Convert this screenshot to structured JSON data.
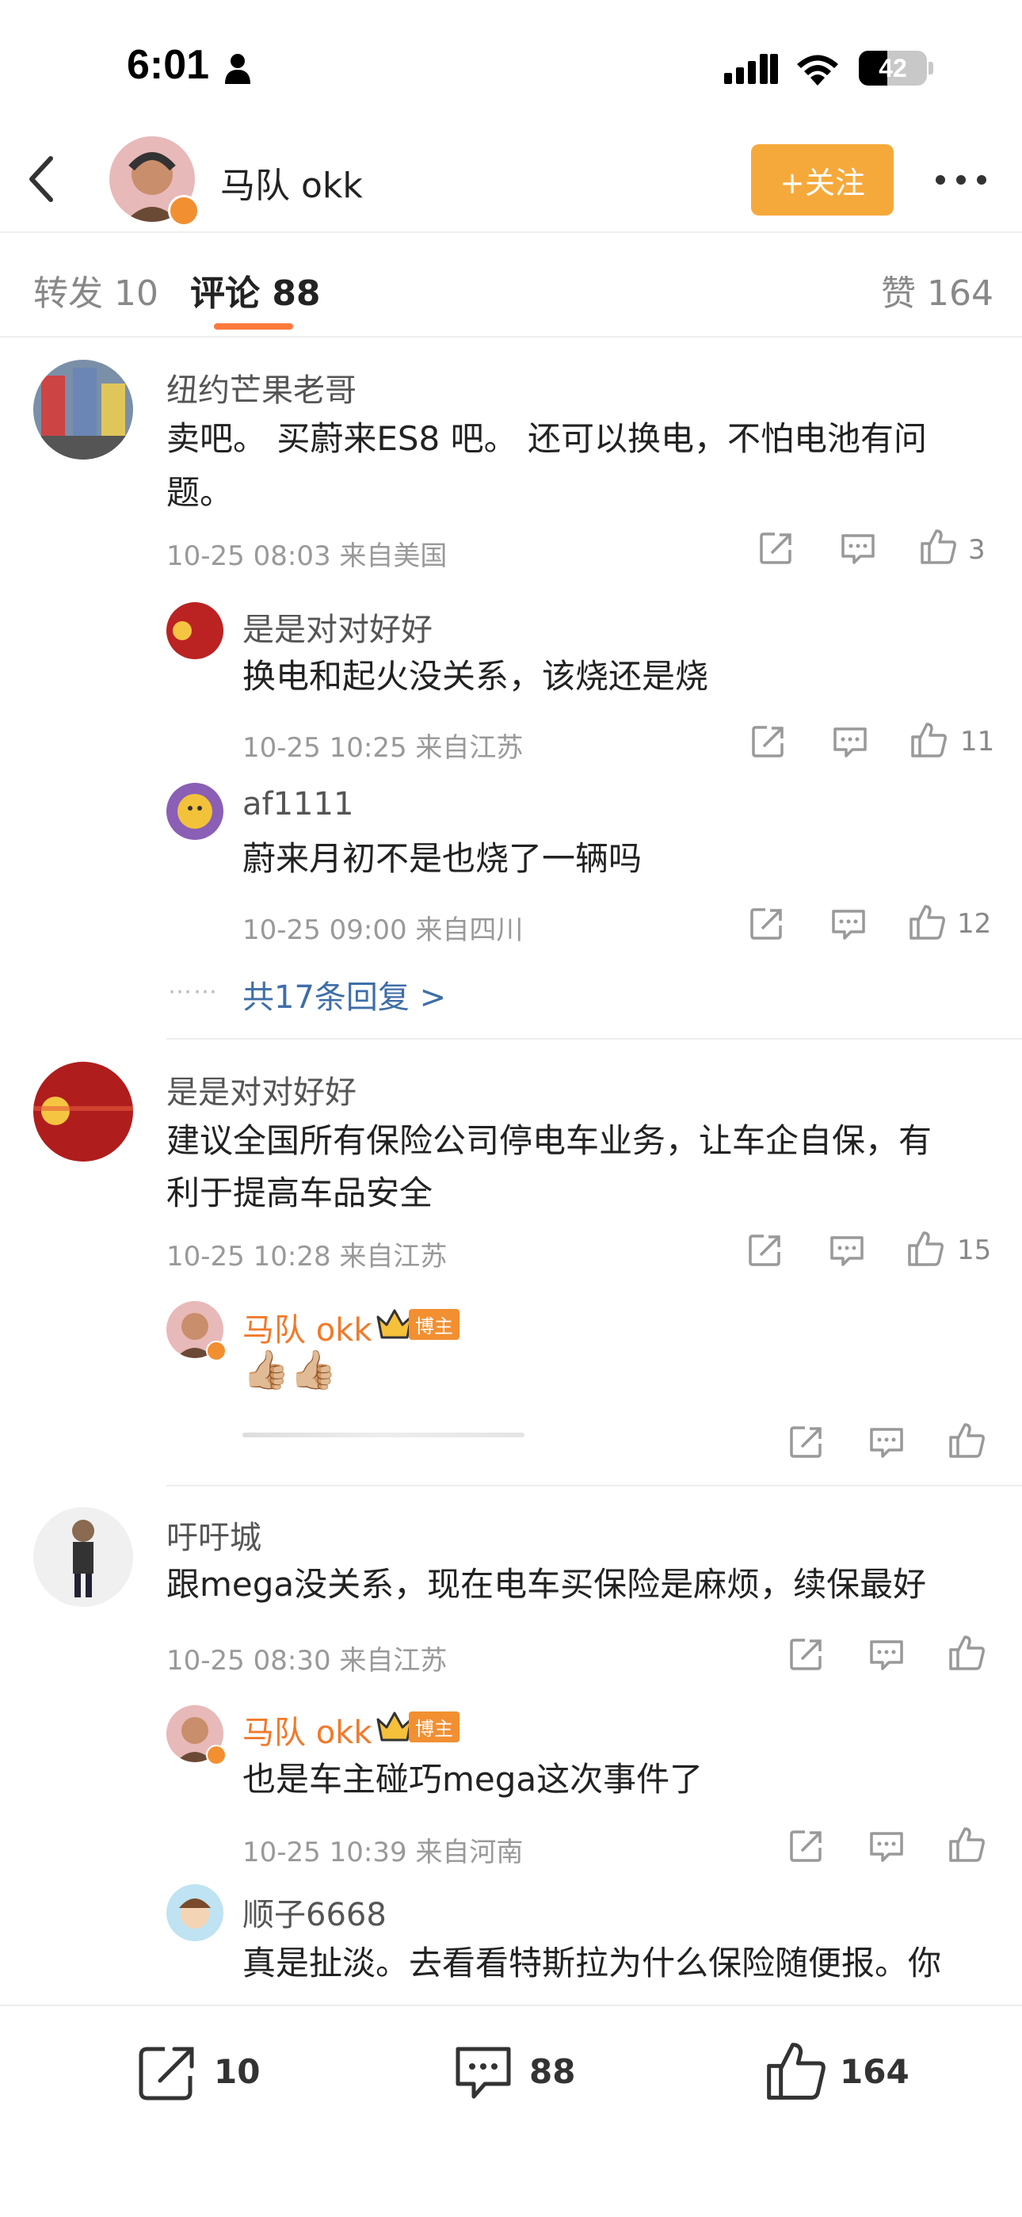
{
  "status_bar": {
    "time": "6:01",
    "battery": "42"
  },
  "header": {
    "user_name": "马队 okk",
    "follow_label": "+关注"
  },
  "tabs": {
    "repost_label": "转发 10",
    "comment_label": "评论 88",
    "like_label": "赞 164"
  },
  "comments": [
    {
      "user": "纽约芒果老哥",
      "text_line1": "卖吧。 买蔚来ES8 吧。 还可以换电，不怕电池有问",
      "text_line2": "题。",
      "meta": "10-25 08:03  来自美国",
      "likes": "3",
      "replies": [
        {
          "user": "是是对对好好",
          "text": "换电和起火没关系，该烧还是烧",
          "meta": "10-25 10:25  来自江苏",
          "likes": "11"
        },
        {
          "user": "af1111",
          "text": "蔚来月初不是也烧了一辆吗",
          "meta": "10-25 09:00  来自四川",
          "likes": "12"
        }
      ],
      "more_replies": "共17条回复 >"
    },
    {
      "user": "是是对对好好",
      "text_line1": "建议全国所有保险公司停电车业务，让车企自保，有",
      "text_line2": "利于提高车品安全",
      "meta": "10-25 10:28  来自江苏",
      "likes": "15",
      "replies": [
        {
          "user": "马队 okk",
          "badge": "博主",
          "text": "👍🏼👍🏼"
        }
      ]
    },
    {
      "user": "吁吁城",
      "text_line1": "跟mega没关系，现在电车买保险是麻烦，续保最好",
      "meta": "10-25 08:30  来自江苏",
      "replies": [
        {
          "user": "马队 okk",
          "badge": "博主",
          "text": "也是车主碰巧mega这次事件了",
          "meta": "10-25 10:39  来自河南"
        },
        {
          "user": "顺子6668",
          "text": "真是扯淡。去看看特斯拉为什么保险随便报。你"
        }
      ]
    }
  ],
  "bottom_bar": {
    "repost_count": "10",
    "comment_count": "88",
    "like_count": "164"
  }
}
